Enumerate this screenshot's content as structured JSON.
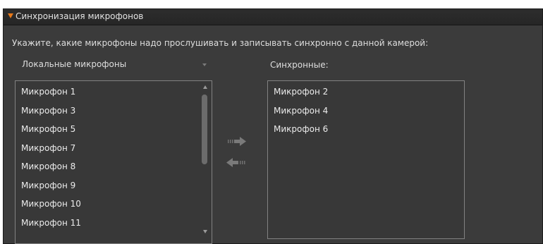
{
  "panel": {
    "title": "Синхронизация микрофонов"
  },
  "instruction": "Укажите, какие микрофоны надо прослушивать и записывать синхронно с данной камерой:",
  "local_select": {
    "selected": "Локальные микрофоны"
  },
  "local_list": {
    "items": [
      "Микрофон 1",
      "Микрофон 3",
      "Микрофон 5",
      "Микрофон 7",
      "Микрофон 8",
      "Микрофон 9",
      "Микрофон 10",
      "Микрофон 11"
    ]
  },
  "sync_list": {
    "title": "Синхронные:",
    "items": [
      "Микрофон 2",
      "Микрофон 4",
      "Микрофон 6"
    ]
  },
  "icons": {
    "expand": "triangle-down-icon",
    "move_right": "arrow-right-icon",
    "move_left": "arrow-left-icon",
    "scroll_up": "chevron-up-icon",
    "scroll_down": "chevron-down-icon"
  },
  "colors": {
    "panel_bg": "#3b3b3b",
    "header_bg": "#262626",
    "accent": "#e8791a",
    "text": "#e6e6e6",
    "list_border": "#828282"
  }
}
